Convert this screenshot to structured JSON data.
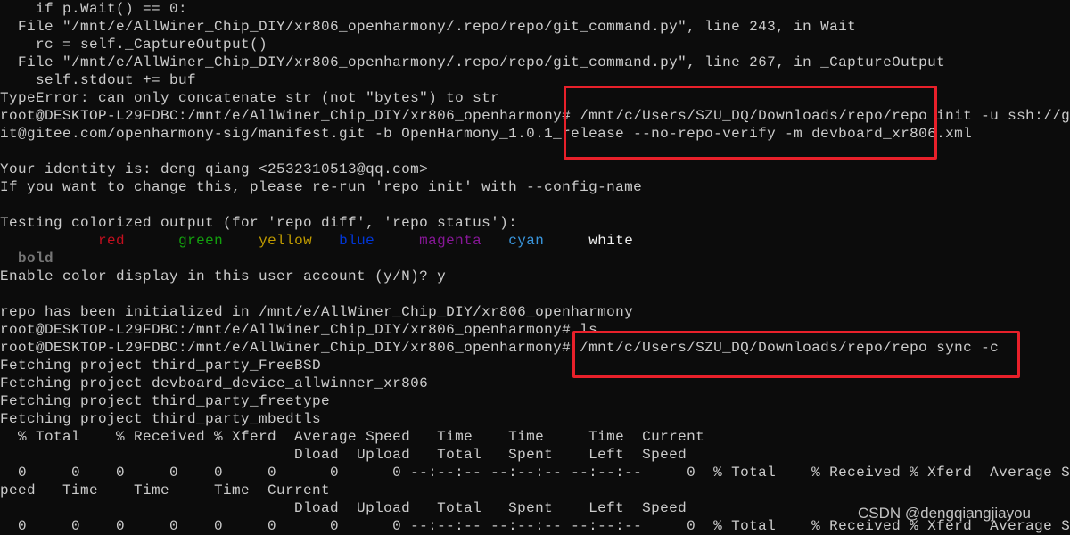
{
  "terminal": {
    "background": "#0c0c0c",
    "foreground": "#cccccc",
    "lines": [
      {
        "text": "    if p.Wait() == 0:"
      },
      {
        "text": "  File \"/mnt/e/AllWiner_Chip_DIY/xr806_openharmony/.repo/repo/git_command.py\", line 243, in Wait"
      },
      {
        "text": "    rc = self._CaptureOutput()"
      },
      {
        "text": "  File \"/mnt/e/AllWiner_Chip_DIY/xr806_openharmony/.repo/repo/git_command.py\", line 267, in _CaptureOutput"
      },
      {
        "text": "    self.stdout += buf"
      },
      {
        "text": "TypeError: can only concatenate str (not \"bytes\") to str"
      },
      {
        "text": "root@DESKTOP-L29FDBC:/mnt/e/AllWiner_Chip_DIY/xr806_openharmony# /mnt/c/Users/SZU_DQ/Downloads/repo/repo init -u ssh://g"
      },
      {
        "text": "it@gitee.com/openharmony-sig/manifest.git -b OpenHarmony_1.0.1_release --no-repo-verify -m devboard_xr806.xml"
      },
      {
        "text": ""
      },
      {
        "text": "Your identity is: deng qiang <2532310513@qq.com>"
      },
      {
        "text": "If you want to change this, please re-run 'repo init' with --config-name"
      },
      {
        "text": ""
      },
      {
        "text": "Testing colorized output (for 'repo diff', 'repo status'):"
      },
      {
        "segments": [
          {
            "text": "           "
          },
          {
            "text": "red",
            "color": "#c50f1f"
          },
          {
            "text": "      "
          },
          {
            "text": "green",
            "color": "#13a10e"
          },
          {
            "text": "    "
          },
          {
            "text": "yellow",
            "color": "#c19c00"
          },
          {
            "text": "   "
          },
          {
            "text": "blue",
            "color": "#0037da"
          },
          {
            "text": "     "
          },
          {
            "text": "magenta",
            "color": "#881798"
          },
          {
            "text": "   "
          },
          {
            "text": "cyan",
            "color": "#3a96dd"
          },
          {
            "text": "     "
          },
          {
            "text": "white",
            "color": "#f2f2f2"
          }
        ]
      },
      {
        "segments": [
          {
            "text": "  "
          },
          {
            "text": "bold",
            "color": "#767676"
          }
        ]
      },
      {
        "text": "Enable color display in this user account (y/N)? y"
      },
      {
        "text": ""
      },
      {
        "text": "repo has been initialized in /mnt/e/AllWiner_Chip_DIY/xr806_openharmony"
      },
      {
        "text": "root@DESKTOP-L29FDBC:/mnt/e/AllWiner_Chip_DIY/xr806_openharmony# ls"
      },
      {
        "text": "root@DESKTOP-L29FDBC:/mnt/e/AllWiner_Chip_DIY/xr806_openharmony# /mnt/c/Users/SZU_DQ/Downloads/repo/repo sync -c"
      },
      {
        "text": "Fetching project third_party_FreeBSD"
      },
      {
        "text": "Fetching project devboard_device_allwinner_xr806"
      },
      {
        "text": "Fetching project third_party_freetype"
      },
      {
        "text": "Fetching project third_party_mbedtls"
      },
      {
        "text": "  % Total    % Received % Xferd  Average Speed   Time    Time     Time  Current"
      },
      {
        "text": "                                 Dload  Upload   Total   Spent    Left  Speed"
      },
      {
        "text": "  0     0    0     0    0     0      0      0 --:--:-- --:--:-- --:--:--     0  % Total    % Received % Xferd  Average S"
      },
      {
        "text": "peed   Time    Time     Time  Current"
      },
      {
        "text": "                                 Dload  Upload   Total   Spent    Left  Speed"
      },
      {
        "text": "  0     0    0     0    0     0      0      0 --:--:-- --:--:-- --:--:--     0  % Total    % Received % Xferd  Average S"
      }
    ]
  },
  "annotations": {
    "highlight_color": "#e8202a"
  },
  "watermark": "CSDN @dengqiangjiayou"
}
